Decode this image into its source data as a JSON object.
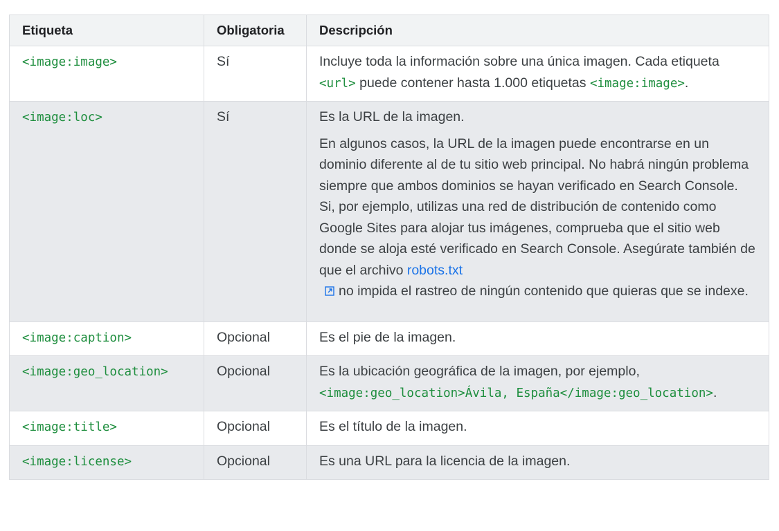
{
  "heading_fragment": "",
  "table": {
    "headers": {
      "tag": "Etiqueta",
      "required": "Obligatoria",
      "description": "Descripción"
    },
    "rows": [
      {
        "tag": "<image:image>",
        "required": "Sí",
        "desc_a": "Incluye toda la información sobre una única imagen. Cada etiqueta ",
        "desc_code_a": "<url>",
        "desc_b": " puede contener hasta 1.000 etiquetas ",
        "desc_code_b": "<image:image>",
        "desc_c": "."
      },
      {
        "tag": "<image:loc>",
        "required": "Sí",
        "desc_p1": "Es la URL de la imagen.",
        "desc_p2_a": "En algunos casos, la URL de la imagen puede encontrarse en un dominio diferente al de tu sitio web principal. No habrá ningún problema siempre que ambos dominios se hayan verificado en Search Console. Si, por ejemplo, utilizas una red de distribución de contenido como Google Sites para alojar tus imágenes, comprueba que el sitio web donde se aloja esté verificado en Search Console. Asegúrate también de que el archivo ",
        "desc_link": "robots.txt",
        "desc_link_icon": "external-link-icon",
        "desc_p2_b": "no impida el rastreo de ningún contenido que quieras que se indexe."
      },
      {
        "tag": "<image:caption>",
        "required": "Opcional",
        "desc": "Es el pie de la imagen."
      },
      {
        "tag": "<image:geo_location>",
        "required": "Opcional",
        "desc_a": "Es la ubicación geográfica de la imagen, por ejemplo, ",
        "desc_code": "<image:geo_location>Ávila, España</image:geo_location>",
        "desc_b": "."
      },
      {
        "tag": "<image:title>",
        "required": "Opcional",
        "desc": "Es el título de la imagen."
      },
      {
        "tag": "<image:license>",
        "required": "Opcional",
        "desc": "Es una URL para la licencia de la imagen."
      }
    ]
  },
  "colors": {
    "code_green": "#1e8e3e",
    "link_blue": "#1a73e8",
    "header_bg": "#f1f3f4",
    "shaded_row_bg": "#e8eaed",
    "border": "#dadce0"
  }
}
